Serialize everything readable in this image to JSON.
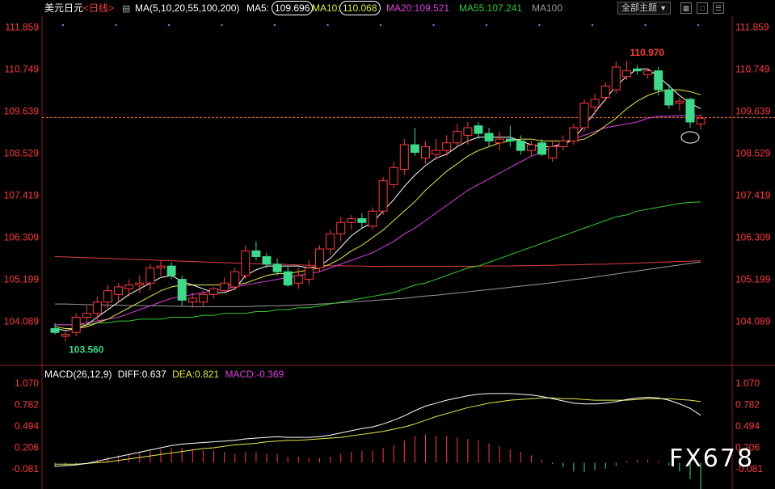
{
  "header": {
    "symbol": "美元日元",
    "period": "<日线>",
    "settings_icon": "sliders-icon",
    "ma_group": "MA(5,10,20,55,100,200)",
    "ma5_label": "MA5:",
    "ma5_value": "109.696",
    "ma10_label": "MA10:",
    "ma10_value": "110.068",
    "ma20": "MA20:109.521",
    "ma55": "MA55:107.241",
    "ma100": "MA100",
    "theme_button": "全部主题",
    "theme_icon": "chevron-down-icon",
    "window_buttons": [
      "grid-icon",
      "window-icon",
      "list-icon"
    ]
  },
  "colors": {
    "up": "#ff3b3b",
    "down": "#3fd98a",
    "ma5": "#ffffff",
    "ma10": "#e8e84a",
    "ma20": "#e040e0",
    "ma55": "#33cc33",
    "ma100": "#9a9a9a",
    "ma200": "#e04040",
    "axis_text": "#ff3b3b"
  },
  "chart_data": [
    {
      "type": "candlestick",
      "title": "美元日元 <日线>",
      "yticks": [
        111.859,
        110.749,
        109.639,
        108.529,
        107.419,
        106.309,
        105.199,
        104.089
      ],
      "ylim": [
        103.4,
        112.1
      ],
      "grid": false,
      "reference_line": 109.47,
      "annotations": {
        "high": "110.970",
        "low": "103.560"
      },
      "candles": [
        {
          "o": 103.9,
          "h": 104.05,
          "l": 103.75,
          "c": 103.8
        },
        {
          "o": 103.7,
          "h": 103.85,
          "l": 103.56,
          "c": 103.75
        },
        {
          "o": 103.8,
          "h": 104.3,
          "l": 103.7,
          "c": 104.2
        },
        {
          "o": 104.2,
          "h": 104.5,
          "l": 103.95,
          "c": 104.3
        },
        {
          "o": 104.3,
          "h": 104.75,
          "l": 104.1,
          "c": 104.6
        },
        {
          "o": 104.6,
          "h": 105.05,
          "l": 104.4,
          "c": 104.9
        },
        {
          "o": 104.8,
          "h": 105.1,
          "l": 104.6,
          "c": 105.0
        },
        {
          "o": 104.95,
          "h": 105.2,
          "l": 104.75,
          "c": 105.05
        },
        {
          "o": 105.05,
          "h": 105.3,
          "l": 104.85,
          "c": 105.1
        },
        {
          "o": 105.1,
          "h": 105.6,
          "l": 104.9,
          "c": 105.5
        },
        {
          "o": 105.5,
          "h": 105.7,
          "l": 105.3,
          "c": 105.55
        },
        {
          "o": 105.55,
          "h": 105.65,
          "l": 105.2,
          "c": 105.3
        },
        {
          "o": 105.2,
          "h": 105.3,
          "l": 104.5,
          "c": 104.65
        },
        {
          "o": 104.6,
          "h": 104.85,
          "l": 104.45,
          "c": 104.7
        },
        {
          "o": 104.6,
          "h": 104.9,
          "l": 104.5,
          "c": 104.8
        },
        {
          "o": 104.8,
          "h": 105.0,
          "l": 104.7,
          "c": 104.95
        },
        {
          "o": 104.9,
          "h": 105.25,
          "l": 104.85,
          "c": 105.1
        },
        {
          "o": 105.0,
          "h": 105.5,
          "l": 104.9,
          "c": 105.4
        },
        {
          "o": 105.3,
          "h": 106.1,
          "l": 105.2,
          "c": 105.95
        },
        {
          "o": 105.95,
          "h": 106.2,
          "l": 105.7,
          "c": 105.8
        },
        {
          "o": 105.8,
          "h": 105.9,
          "l": 105.5,
          "c": 105.6
        },
        {
          "o": 105.6,
          "h": 105.75,
          "l": 105.3,
          "c": 105.4
        },
        {
          "o": 105.4,
          "h": 105.55,
          "l": 105.0,
          "c": 105.05
        },
        {
          "o": 105.1,
          "h": 105.5,
          "l": 104.95,
          "c": 105.3
        },
        {
          "o": 105.2,
          "h": 105.7,
          "l": 105.05,
          "c": 105.5
        },
        {
          "o": 105.5,
          "h": 106.1,
          "l": 105.4,
          "c": 106.0
        },
        {
          "o": 106.0,
          "h": 106.5,
          "l": 105.85,
          "c": 106.4
        },
        {
          "o": 106.4,
          "h": 106.85,
          "l": 106.2,
          "c": 106.7
        },
        {
          "o": 106.7,
          "h": 106.9,
          "l": 106.5,
          "c": 106.8
        },
        {
          "o": 106.8,
          "h": 106.95,
          "l": 106.55,
          "c": 106.7
        },
        {
          "o": 106.6,
          "h": 107.1,
          "l": 106.5,
          "c": 107.0
        },
        {
          "o": 107.0,
          "h": 107.9,
          "l": 106.9,
          "c": 107.8
        },
        {
          "o": 107.7,
          "h": 108.3,
          "l": 107.6,
          "c": 108.15
        },
        {
          "o": 108.1,
          "h": 108.9,
          "l": 107.95,
          "c": 108.75
        },
        {
          "o": 108.75,
          "h": 109.2,
          "l": 108.45,
          "c": 108.55
        },
        {
          "o": 108.4,
          "h": 108.85,
          "l": 108.25,
          "c": 108.7
        },
        {
          "o": 108.5,
          "h": 108.9,
          "l": 108.35,
          "c": 108.6
        },
        {
          "o": 108.6,
          "h": 109.0,
          "l": 108.45,
          "c": 108.8
        },
        {
          "o": 108.8,
          "h": 109.3,
          "l": 108.7,
          "c": 109.1
        },
        {
          "o": 109.0,
          "h": 109.35,
          "l": 108.75,
          "c": 109.2
        },
        {
          "o": 109.25,
          "h": 109.35,
          "l": 108.9,
          "c": 109.05
        },
        {
          "o": 109.05,
          "h": 109.2,
          "l": 108.7,
          "c": 108.85
        },
        {
          "o": 108.8,
          "h": 109.1,
          "l": 108.6,
          "c": 108.9
        },
        {
          "o": 108.9,
          "h": 109.25,
          "l": 108.7,
          "c": 108.85
        },
        {
          "o": 108.85,
          "h": 109.0,
          "l": 108.5,
          "c": 108.6
        },
        {
          "o": 108.6,
          "h": 108.85,
          "l": 108.45,
          "c": 108.75
        },
        {
          "o": 108.8,
          "h": 108.9,
          "l": 108.45,
          "c": 108.5
        },
        {
          "o": 108.4,
          "h": 108.85,
          "l": 108.3,
          "c": 108.7
        },
        {
          "o": 108.7,
          "h": 109.0,
          "l": 108.6,
          "c": 108.85
        },
        {
          "o": 108.85,
          "h": 109.3,
          "l": 108.75,
          "c": 109.2
        },
        {
          "o": 109.2,
          "h": 109.95,
          "l": 109.1,
          "c": 109.85
        },
        {
          "o": 109.75,
          "h": 110.1,
          "l": 109.55,
          "c": 109.95
        },
        {
          "o": 110.0,
          "h": 110.4,
          "l": 109.9,
          "c": 110.3
        },
        {
          "o": 110.2,
          "h": 110.95,
          "l": 110.1,
          "c": 110.8
        },
        {
          "o": 110.55,
          "h": 110.97,
          "l": 110.45,
          "c": 110.7
        },
        {
          "o": 110.75,
          "h": 110.85,
          "l": 110.6,
          "c": 110.7
        },
        {
          "o": 110.6,
          "h": 110.75,
          "l": 110.5,
          "c": 110.7
        },
        {
          "o": 110.7,
          "h": 110.8,
          "l": 110.05,
          "c": 110.2
        },
        {
          "o": 110.2,
          "h": 110.35,
          "l": 109.7,
          "c": 109.8
        },
        {
          "o": 109.85,
          "h": 110.0,
          "l": 109.65,
          "c": 109.9
        },
        {
          "o": 109.95,
          "h": 110.0,
          "l": 109.2,
          "c": 109.35
        },
        {
          "o": 109.3,
          "h": 109.55,
          "l": 109.15,
          "c": 109.45
        }
      ],
      "moving_averages": [
        {
          "name": "MA5",
          "values": [
            103.9,
            103.85,
            103.9,
            104.0,
            104.2,
            104.4,
            104.6,
            104.8,
            104.95,
            105.1,
            105.25,
            105.3,
            105.15,
            105.05,
            104.95,
            104.85,
            104.85,
            104.95,
            105.3,
            105.45,
            105.55,
            105.55,
            105.55,
            105.55,
            105.5,
            105.55,
            105.75,
            106.05,
            106.35,
            106.55,
            106.7,
            107.0,
            107.3,
            107.65,
            107.95,
            108.2,
            108.4,
            108.5,
            108.7,
            108.85,
            108.95,
            108.95,
            108.95,
            108.95,
            108.85,
            108.75,
            108.7,
            108.7,
            108.75,
            108.9,
            109.25,
            109.6,
            109.95,
            110.3,
            110.55,
            110.75,
            110.75,
            110.55,
            110.3,
            110.05,
            109.85,
            109.7
          ]
        },
        {
          "name": "MA10",
          "values": [
            103.95,
            103.9,
            103.9,
            103.95,
            104.05,
            104.15,
            104.3,
            104.45,
            104.6,
            104.75,
            104.9,
            105.0,
            105.05,
            105.05,
            105.05,
            105.05,
            105.05,
            105.05,
            105.1,
            105.2,
            105.3,
            105.35,
            105.35,
            105.4,
            105.45,
            105.5,
            105.6,
            105.75,
            105.95,
            106.1,
            106.3,
            106.5,
            106.75,
            107.0,
            107.25,
            107.55,
            107.8,
            108.05,
            108.25,
            108.45,
            108.6,
            108.7,
            108.8,
            108.85,
            108.9,
            108.9,
            108.85,
            108.85,
            108.85,
            108.85,
            108.9,
            109.05,
            109.25,
            109.45,
            109.7,
            109.9,
            110.05,
            110.15,
            110.2,
            110.2,
            110.15,
            110.07
          ]
        },
        {
          "name": "MA20",
          "values": [
            104.0,
            104.0,
            104.0,
            104.05,
            104.1,
            104.15,
            104.2,
            104.3,
            104.4,
            104.5,
            104.6,
            104.7,
            104.75,
            104.8,
            104.85,
            104.9,
            104.95,
            105.0,
            105.05,
            105.1,
            105.15,
            105.2,
            105.25,
            105.3,
            105.35,
            105.4,
            105.5,
            105.6,
            105.7,
            105.8,
            105.9,
            106.05,
            106.2,
            106.4,
            106.55,
            106.75,
            106.95,
            107.15,
            107.35,
            107.55,
            107.7,
            107.85,
            108.0,
            108.15,
            108.3,
            108.45,
            108.55,
            108.7,
            108.8,
            108.9,
            109.0,
            109.1,
            109.2,
            109.25,
            109.3,
            109.35,
            109.45,
            109.5,
            109.5,
            109.52,
            109.52,
            109.52
          ]
        },
        {
          "name": "MA55",
          "values": [
            104.0,
            104.0,
            104.0,
            104.0,
            104.05,
            104.05,
            104.1,
            104.1,
            104.15,
            104.15,
            104.15,
            104.2,
            104.2,
            104.2,
            104.25,
            104.25,
            104.3,
            104.3,
            104.3,
            104.35,
            104.35,
            104.4,
            104.4,
            104.45,
            104.45,
            104.5,
            104.55,
            104.6,
            104.65,
            104.7,
            104.75,
            104.8,
            104.85,
            104.95,
            105.05,
            105.1,
            105.2,
            105.3,
            105.4,
            105.5,
            105.55,
            105.65,
            105.75,
            105.85,
            105.95,
            106.05,
            106.15,
            106.25,
            106.35,
            106.45,
            106.55,
            106.65,
            106.75,
            106.85,
            106.9,
            107.0,
            107.05,
            107.1,
            107.15,
            107.2,
            107.23,
            107.24
          ]
        },
        {
          "name": "MA100",
          "values": [
            104.55,
            104.55,
            104.54,
            104.53,
            104.53,
            104.52,
            104.52,
            104.51,
            104.51,
            104.5,
            104.5,
            104.49,
            104.49,
            104.48,
            104.48,
            104.48,
            104.48,
            104.48,
            104.48,
            104.49,
            104.5,
            104.5,
            104.51,
            104.52,
            104.53,
            104.55,
            104.56,
            104.58,
            104.6,
            104.62,
            104.64,
            104.66,
            104.68,
            104.7,
            104.73,
            104.76,
            104.78,
            104.81,
            104.84,
            104.87,
            104.9,
            104.93,
            104.96,
            104.99,
            105.02,
            105.05,
            105.08,
            105.11,
            105.15,
            105.19,
            105.22,
            105.26,
            105.3,
            105.34,
            105.38,
            105.42,
            105.46,
            105.5,
            105.54,
            105.58,
            105.62,
            105.66
          ]
        },
        {
          "name": "MA200",
          "values": [
            105.8,
            105.79,
            105.78,
            105.77,
            105.76,
            105.75,
            105.74,
            105.73,
            105.72,
            105.71,
            105.7,
            105.69,
            105.68,
            105.67,
            105.66,
            105.65,
            105.64,
            105.63,
            105.62,
            105.61,
            105.6,
            105.6,
            105.59,
            105.58,
            105.57,
            105.57,
            105.56,
            105.56,
            105.55,
            105.55,
            105.54,
            105.54,
            105.54,
            105.54,
            105.54,
            105.54,
            105.54,
            105.54,
            105.54,
            105.54,
            105.55,
            105.55,
            105.55,
            105.55,
            105.56,
            105.56,
            105.57,
            105.57,
            105.58,
            105.58,
            105.59,
            105.6,
            105.6,
            105.61,
            105.62,
            105.63,
            105.64,
            105.65,
            105.66,
            105.67,
            105.68,
            105.69
          ]
        }
      ]
    },
    {
      "type": "macd",
      "title": "MACD(26,12,9)",
      "diff_label": "DIFF:0.637",
      "dea_label": "DEA:0.821",
      "macd_label": "MACD:-0.369",
      "yticks": [
        1.07,
        0.782,
        0.494,
        0.206,
        -0.081
      ],
      "ytick_labels": [
        "1.070",
        "0.782",
        "0.494",
        "0.206",
        "-0.081"
      ],
      "ylim": [
        -0.3,
        1.2
      ],
      "diff": [
        -0.05,
        -0.04,
        -0.03,
        -0.01,
        0.02,
        0.05,
        0.08,
        0.11,
        0.14,
        0.17,
        0.2,
        0.23,
        0.25,
        0.26,
        0.27,
        0.28,
        0.29,
        0.3,
        0.32,
        0.33,
        0.34,
        0.35,
        0.34,
        0.34,
        0.34,
        0.35,
        0.37,
        0.4,
        0.43,
        0.46,
        0.48,
        0.52,
        0.57,
        0.63,
        0.7,
        0.76,
        0.8,
        0.84,
        0.87,
        0.9,
        0.92,
        0.93,
        0.93,
        0.93,
        0.92,
        0.91,
        0.89,
        0.86,
        0.83,
        0.8,
        0.79,
        0.79,
        0.8,
        0.82,
        0.85,
        0.87,
        0.88,
        0.87,
        0.84,
        0.79,
        0.73,
        0.637
      ],
      "dea": [
        -0.02,
        -0.02,
        -0.02,
        -0.01,
        0.0,
        0.01,
        0.03,
        0.05,
        0.07,
        0.09,
        0.11,
        0.13,
        0.15,
        0.17,
        0.19,
        0.2,
        0.22,
        0.24,
        0.25,
        0.26,
        0.28,
        0.29,
        0.3,
        0.3,
        0.31,
        0.32,
        0.33,
        0.34,
        0.36,
        0.38,
        0.4,
        0.42,
        0.45,
        0.48,
        0.52,
        0.57,
        0.62,
        0.66,
        0.7,
        0.74,
        0.77,
        0.8,
        0.82,
        0.84,
        0.85,
        0.86,
        0.87,
        0.87,
        0.86,
        0.86,
        0.85,
        0.84,
        0.84,
        0.84,
        0.84,
        0.85,
        0.86,
        0.86,
        0.86,
        0.85,
        0.84,
        0.821
      ],
      "macd": [
        -0.06,
        -0.04,
        -0.02,
        0.0,
        0.04,
        0.08,
        0.1,
        0.12,
        0.14,
        0.16,
        0.18,
        0.2,
        0.2,
        0.18,
        0.16,
        0.16,
        0.14,
        0.12,
        0.14,
        0.14,
        0.12,
        0.12,
        0.08,
        0.08,
        0.06,
        0.06,
        0.08,
        0.12,
        0.14,
        0.16,
        0.16,
        0.2,
        0.24,
        0.3,
        0.36,
        0.38,
        0.36,
        0.36,
        0.34,
        0.32,
        0.3,
        0.26,
        0.22,
        0.18,
        0.14,
        0.1,
        0.04,
        -0.02,
        -0.06,
        -0.12,
        -0.12,
        -0.1,
        -0.08,
        -0.04,
        0.02,
        0.04,
        0.04,
        0.02,
        -0.04,
        -0.12,
        -0.22,
        -0.369
      ]
    }
  ],
  "watermark": "FX678"
}
